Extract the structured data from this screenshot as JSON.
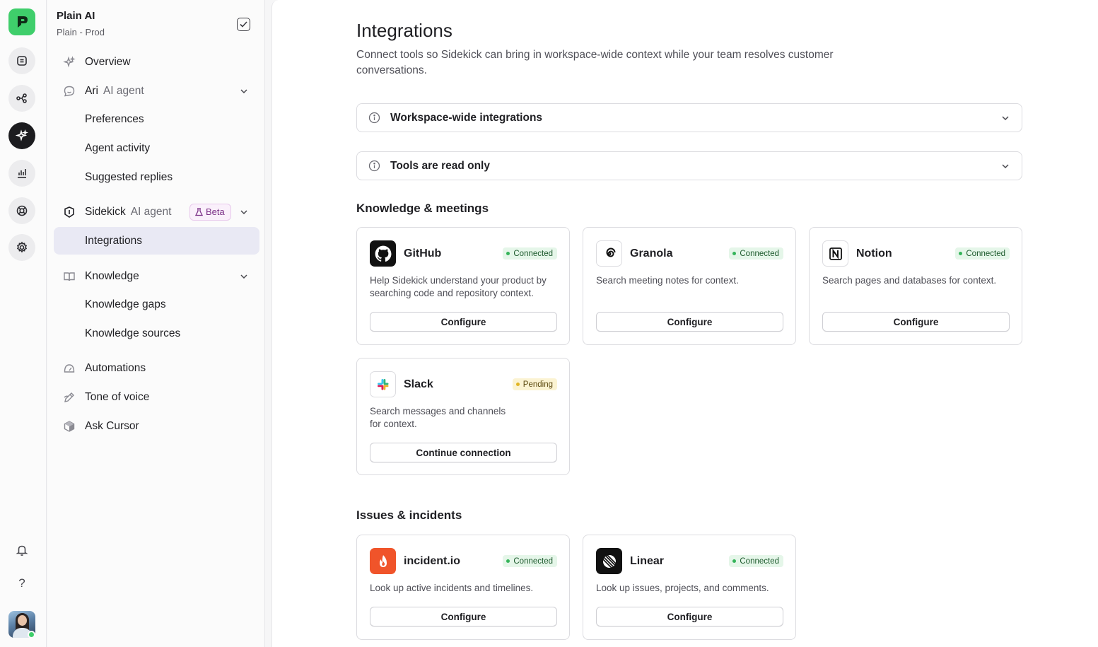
{
  "workspace": {
    "name": "Plain AI",
    "subtitle": "Plain - Prod"
  },
  "rail": {
    "icons": [
      "plain-logo",
      "inbox-icon",
      "workflow-icon",
      "sparkles-icon",
      "chart-icon",
      "lifebuoy-icon",
      "gear-icon",
      "bell-icon",
      "help-icon",
      "avatar"
    ],
    "help_glyph": "?",
    "active": "sparkles-icon"
  },
  "sidebar": {
    "overview": "Overview",
    "ari": {
      "label": "Ari",
      "sub": "AI agent"
    },
    "ari_children": [
      "Preferences",
      "Agent activity",
      "Suggested replies"
    ],
    "sidekick": {
      "label": "Sidekick",
      "sub": "AI agent",
      "badge": "Beta"
    },
    "sidekick_children": [
      "Integrations"
    ],
    "knowledge": "Knowledge",
    "knowledge_children": [
      "Knowledge gaps",
      "Knowledge sources"
    ],
    "automations": "Automations",
    "tone_of_voice": "Tone of voice",
    "ask_cursor": "Ask Cursor",
    "active_item": "Integrations"
  },
  "main": {
    "title": "Integrations",
    "description": "Connect tools so Sidekick can bring in workspace-wide context while your team resolves customer conversations.",
    "accordions": [
      "Workspace-wide integrations",
      "Tools are read only"
    ],
    "sections": {
      "knowledge_title": "Knowledge & meetings",
      "issues_title": "Issues & incidents"
    },
    "cards": {
      "github": {
        "name": "GitHub",
        "status": "Connected",
        "description": "Help Sidekick understand your product by searching code and repository context.",
        "button": "Configure"
      },
      "granola": {
        "name": "Granola",
        "status": "Connected",
        "description": "Search meeting notes for context.",
        "button": "Configure"
      },
      "notion": {
        "name": "Notion",
        "status": "Connected",
        "description": "Search pages and databases for context.",
        "button": "Configure"
      },
      "slack": {
        "name": "Slack",
        "status": "Pending",
        "description": "Search messages and channels for context.",
        "button": "Continue connection"
      },
      "incident": {
        "name": "incident.io",
        "status": "Connected",
        "description": "Look up active incidents and timelines.",
        "button": "Configure"
      },
      "linear": {
        "name": "Linear",
        "status": "Connected",
        "description": "Look up issues, projects, and comments.",
        "button": "Configure"
      }
    }
  },
  "colors": {
    "brand_green": "#3fce6b",
    "active_nav_bg": "#e9e9f4",
    "connected_bg": "#e5f6e9",
    "pending_bg": "#fbf3d2",
    "incident_orange": "#f0542a"
  }
}
